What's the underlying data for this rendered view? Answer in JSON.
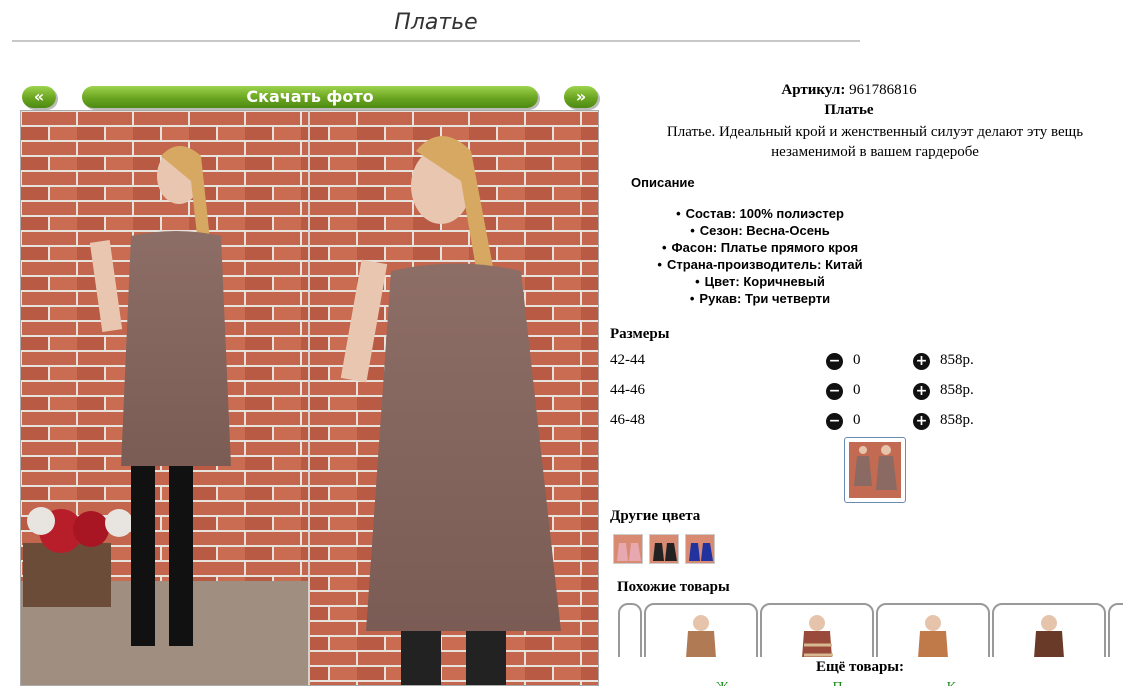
{
  "page": {
    "title": "Платье"
  },
  "gallery": {
    "prev_label": "«",
    "next_label": "»",
    "download_label": "Скачать фото"
  },
  "product": {
    "article_label": "Артикул:",
    "article_value": "961786816",
    "name": "Платье",
    "description": "Платье. Идеальный крой и женственный силуэт делают эту вещь незаменимой в вашем гардеробе"
  },
  "details": {
    "heading": "Описание",
    "items": [
      "Состав: 100% полиэстер",
      "Сезон: Весна-Осень",
      "Фасон: Платье прямого кроя",
      "Страна-производитель: Китай",
      "Цвет: Коричневый",
      "Рукав: Три четверти"
    ]
  },
  "sizes": {
    "heading": "Размеры",
    "rows": [
      {
        "size": "42-44",
        "qty": "0",
        "price": "858р."
      },
      {
        "size": "44-46",
        "qty": "0",
        "price": "858р."
      },
      {
        "size": "46-48",
        "qty": "0",
        "price": "858р."
      }
    ]
  },
  "other_colors": {
    "heading": "Другие цвета"
  },
  "similar": {
    "heading": "Похожие товары"
  },
  "more": {
    "label": "Ещё товары:",
    "links": [
      "Ж",
      "П",
      "К"
    ]
  },
  "colors": {
    "accent_green": "#6aa521",
    "dress": "#8a6a62",
    "brick": "#c0604a",
    "link_green": "#1a8a1a"
  }
}
